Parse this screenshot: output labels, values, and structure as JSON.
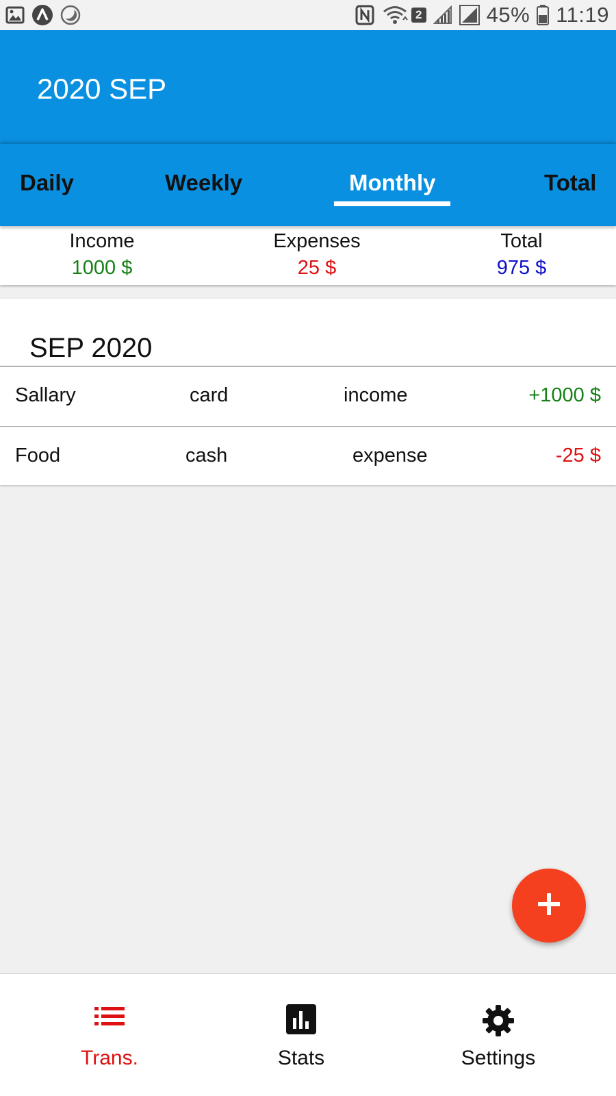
{
  "status_bar": {
    "left_icons": [
      "image-icon",
      "a-circle-icon",
      "moon-icon"
    ],
    "right_icons": [
      "nfc-icon",
      "wifi-icon",
      "signal-icon",
      "signal-full-icon",
      "battery-icon"
    ],
    "sim_badge": "2",
    "battery": "45%",
    "time": "11:19"
  },
  "app_bar": {
    "title": "2020 SEP"
  },
  "tabs": {
    "items": [
      {
        "label": "Daily"
      },
      {
        "label": "Weekly"
      },
      {
        "label": "Monthly"
      },
      {
        "label": "Total"
      }
    ],
    "active": "Monthly"
  },
  "summary": {
    "income": {
      "label": "Income",
      "value": "1000 $"
    },
    "expenses": {
      "label": "Expenses",
      "value": "25 $"
    },
    "total": {
      "label": "Total",
      "value": "975 $"
    }
  },
  "month": {
    "title": "SEP 2020",
    "rows": [
      {
        "category": "Sallary",
        "account": "card",
        "type": "income",
        "amount": "+1000 $"
      },
      {
        "category": "Food",
        "account": "cash",
        "type": "expense",
        "amount": "-25 $"
      }
    ]
  },
  "fab": {
    "icon": "plus-icon"
  },
  "bottom_nav": {
    "items": [
      {
        "label": "Trans.",
        "icon": "list-icon"
      },
      {
        "label": "Stats",
        "icon": "bar-chart-icon"
      },
      {
        "label": "Settings",
        "icon": "gear-icon"
      }
    ],
    "active": "Trans."
  },
  "colors": {
    "primary": "#0a90e0",
    "income": "#168016",
    "expense": "#dd1111",
    "total": "#1010cc",
    "accent": "#f4401e",
    "active_nav": "#dd1111"
  }
}
